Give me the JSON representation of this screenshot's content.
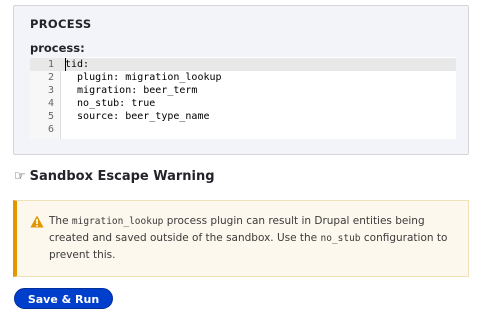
{
  "process": {
    "legend": "PROCESS",
    "field_label": "process:",
    "line_numbers": [
      "1",
      "2",
      "3",
      "4",
      "5",
      "6"
    ],
    "code_lines": [
      "tid:",
      "  plugin: migration_lookup",
      "  migration: beer_term",
      "  no_stub: true",
      "  source: beer_type_name",
      ""
    ]
  },
  "warning": {
    "hand_icon": "☞",
    "heading": "Sandbox Escape Warning",
    "icon": "warning-triangle",
    "text_1": "The ",
    "code_1": "migration_lookup",
    "text_2": " process plugin can result in Drupal entities being created and saved outside of the sandbox. Use the ",
    "code_2": "no_stub",
    "text_3": " configuration to prevent this.",
    "accent_color": "#e29700",
    "background_color": "#fdf8ed"
  },
  "actions": {
    "save_run_label": "Save & Run",
    "button_color": "#003ecc"
  }
}
